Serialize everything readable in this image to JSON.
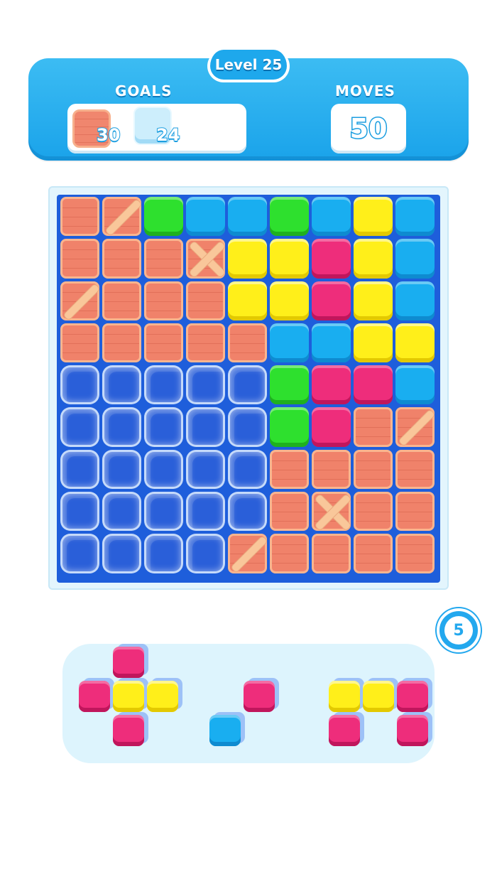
{
  "header": {
    "level_label": "Level 25",
    "goals_label": "GOALS",
    "moves_label": "MOVES",
    "moves_value": "50",
    "goals": [
      {
        "type": "wood-crate",
        "count": "30"
      },
      {
        "type": "ice-block",
        "count": "24"
      }
    ]
  },
  "board": {
    "rows": 9,
    "cols": 9,
    "legend": {
      "W": "wood",
      "P": "wood-plank",
      "X": "wood-cross",
      "I": "ice",
      "G": "green",
      "B": "blue",
      "Y": "yellow",
      "K": "pink"
    },
    "grid": [
      [
        "W",
        "P",
        "G",
        "B",
        "B",
        "G",
        "B",
        "Y",
        "B"
      ],
      [
        "W",
        "W",
        "W",
        "X",
        "Y",
        "Y",
        "K",
        "Y",
        "B"
      ],
      [
        "P",
        "W",
        "W",
        "W",
        "Y",
        "Y",
        "K",
        "Y",
        "B"
      ],
      [
        "W",
        "W",
        "W",
        "W",
        "W",
        "B",
        "B",
        "Y",
        "Y"
      ],
      [
        "I",
        "I",
        "I",
        "I",
        "I",
        "G",
        "K",
        "K",
        "B"
      ],
      [
        "I",
        "I",
        "I",
        "I",
        "I",
        "G",
        "K",
        "W",
        "P"
      ],
      [
        "I",
        "I",
        "I",
        "I",
        "I",
        "W",
        "W",
        "W",
        "W"
      ],
      [
        "I",
        "I",
        "I",
        "I",
        "I",
        "W",
        "X",
        "W",
        "W"
      ],
      [
        "I",
        "I",
        "I",
        "I",
        "P",
        "W",
        "W",
        "W",
        "W"
      ]
    ]
  },
  "counter_badge": "5",
  "tray": {
    "pieces": [
      {
        "name": "plus-piece",
        "blocks": [
          "pink",
          "pink",
          "yellow",
          "yellow",
          "pink"
        ]
      },
      {
        "name": "diagonal-piece",
        "blocks": [
          "pink",
          "blue"
        ]
      },
      {
        "name": "u-piece",
        "blocks": [
          "yellow",
          "yellow",
          "pink",
          "pink",
          "pink"
        ]
      }
    ]
  },
  "colors": {
    "header_blue": "#1ea8ec",
    "board_blue": "#1e5edb",
    "green": "#2ee02e",
    "blue": "#19aef0",
    "yellow": "#ffef1a",
    "pink": "#ee2d7b",
    "wood": "#f0826a"
  }
}
